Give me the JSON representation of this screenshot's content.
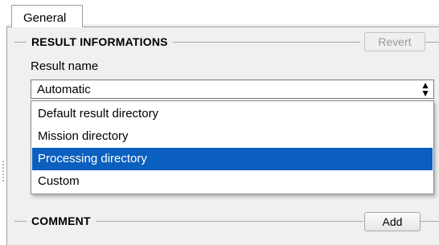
{
  "tabs": [
    {
      "label": "General",
      "active": true
    }
  ],
  "result_group": {
    "title": "RESULT INFORMATIONS",
    "revert_label": "Revert",
    "revert_enabled": false,
    "result_name_label": "Result name",
    "combo_value": "Automatic",
    "dropdown_options": [
      "Default result directory",
      "Mission directory",
      "Processing directory",
      "Custom"
    ],
    "highlighted_option": "Processing directory"
  },
  "comment_group": {
    "title": "COMMENT",
    "add_label": "Add"
  },
  "icons": {
    "combo_arrow": "up-down-arrows-icon"
  },
  "colors": {
    "selection": "#0a5fbf",
    "panel_bg": "#f0f0f0"
  }
}
